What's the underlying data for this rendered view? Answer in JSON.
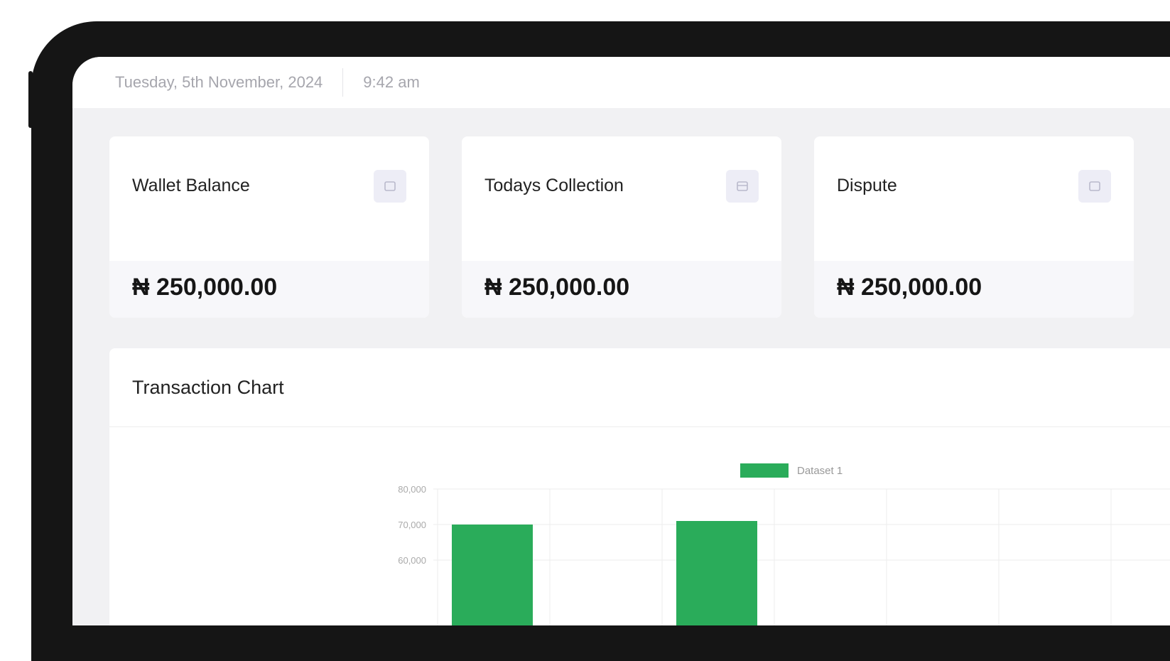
{
  "header": {
    "date": "Tuesday, 5th November, 2024",
    "time": "9:42 am"
  },
  "cards": [
    {
      "title": "Wallet Balance",
      "amount": "₦ 250,000.00",
      "icon": "wallet-icon"
    },
    {
      "title": "Todays Collection",
      "amount": "₦ 250,000.00",
      "icon": "collection-icon"
    },
    {
      "title": "Dispute",
      "amount": "₦ 250,000.00",
      "icon": "dispute-icon"
    }
  ],
  "chart_panel": {
    "title": "Transaction Chart"
  },
  "colors": {
    "bar": "#2aac5a",
    "device_frame": "#151515"
  },
  "chart_data": {
    "type": "bar",
    "series": [
      {
        "name": "Dataset 1",
        "values": [
          70000,
          null,
          71000,
          null,
          null,
          null,
          null
        ]
      }
    ],
    "y_ticks": [
      "80,000",
      "70,000",
      "60,000"
    ],
    "ylim": [
      60000,
      80000
    ],
    "grid": true,
    "legend": "top"
  }
}
